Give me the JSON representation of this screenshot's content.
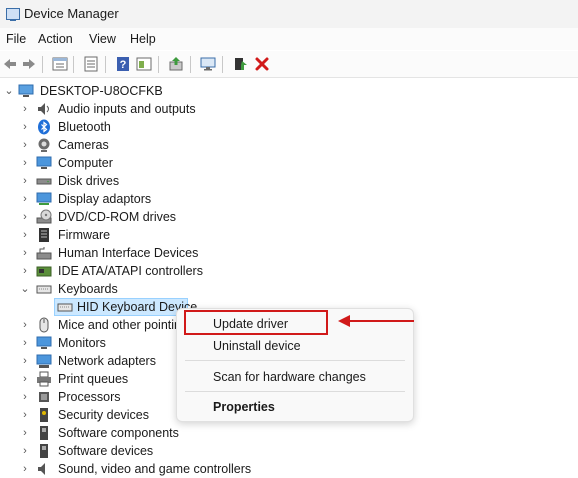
{
  "window": {
    "title": "Device Manager"
  },
  "menu": {
    "items": [
      "File",
      "Action",
      "View",
      "Help"
    ]
  },
  "toolbar": {
    "icons": [
      "back-icon",
      "forward-icon",
      "properties-icon",
      "console-tree-icon",
      "help-icon",
      "refresh-view-icon",
      "update-driver-toolbar-icon",
      "scan-hardware-icon",
      "enable-device-icon",
      "uninstall-icon"
    ]
  },
  "tree": {
    "root": "DESKTOP-U8OCFKB",
    "categories": [
      {
        "label": "Audio inputs and outputs",
        "icon": "speaker-icon",
        "expanded": false
      },
      {
        "label": "Bluetooth",
        "icon": "bluetooth-icon",
        "expanded": false
      },
      {
        "label": "Cameras",
        "icon": "camera-icon",
        "expanded": false
      },
      {
        "label": "Computer",
        "icon": "monitor-icon",
        "expanded": false
      },
      {
        "label": "Disk drives",
        "icon": "disk-drive-icon",
        "expanded": false
      },
      {
        "label": "Display adaptors",
        "icon": "display-adapter-icon",
        "expanded": false
      },
      {
        "label": "DVD/CD-ROM drives",
        "icon": "dvd-icon",
        "expanded": false
      },
      {
        "label": "Firmware",
        "icon": "firmware-icon",
        "expanded": false
      },
      {
        "label": "Human Interface Devices",
        "icon": "hid-icon",
        "expanded": false
      },
      {
        "label": "IDE ATA/ATAPI controllers",
        "icon": "ide-icon",
        "expanded": false
      },
      {
        "label": "Keyboards",
        "icon": "keyboard-icon",
        "expanded": true
      },
      {
        "label": "HID Keyboard Device",
        "icon": "keyboard-icon",
        "child": true,
        "selected": true
      },
      {
        "label": "Mice and other pointin",
        "icon": "mouse-icon",
        "expanded": false
      },
      {
        "label": "Monitors",
        "icon": "monitor-icon",
        "expanded": false
      },
      {
        "label": "Network adapters",
        "icon": "network-icon",
        "expanded": false
      },
      {
        "label": "Print queues",
        "icon": "printer-icon",
        "expanded": false
      },
      {
        "label": "Processors",
        "icon": "processor-icon",
        "expanded": false
      },
      {
        "label": "Security devices",
        "icon": "security-icon",
        "expanded": false
      },
      {
        "label": "Software components",
        "icon": "software-icon",
        "expanded": false
      },
      {
        "label": "Software devices",
        "icon": "software-icon",
        "expanded": false
      },
      {
        "label": "Sound, video and game controllers",
        "icon": "speaker-icon",
        "expanded": false
      }
    ]
  },
  "context_menu": {
    "items": [
      "Update driver",
      "Uninstall device",
      "Scan for hardware changes",
      "Properties"
    ]
  },
  "colors": {
    "highlight": "#d11a1a",
    "selection": "#cce8ff"
  }
}
